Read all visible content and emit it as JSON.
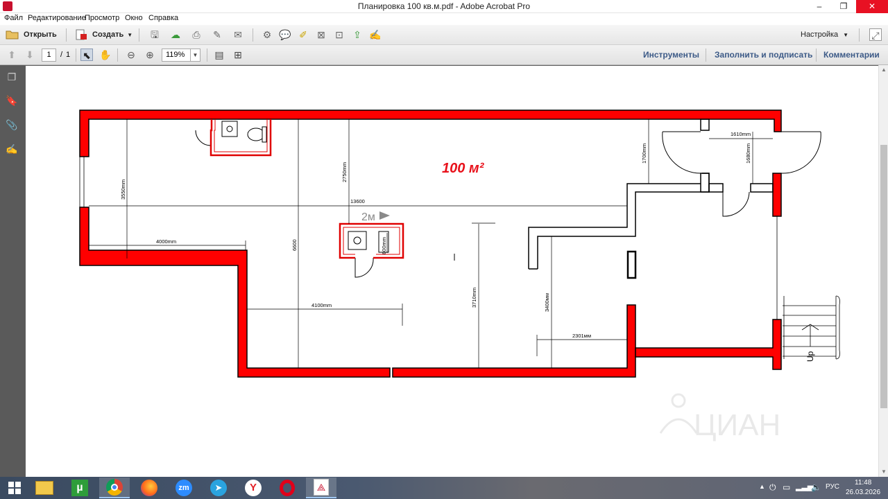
{
  "window": {
    "title": "Планировка 100 кв.м.pdf - Adobe Acrobat Pro",
    "minimize": "–",
    "restore": "❐",
    "close": "✕"
  },
  "menu": [
    "Файл",
    "Редактирование",
    "Просмотр",
    "Окно",
    "Справка"
  ],
  "toolbar": {
    "open_label": "Открыть",
    "create_label": "Создать",
    "customize_label": "Настройка"
  },
  "nav": {
    "page_current": "1",
    "page_sep": "/",
    "page_total": "1",
    "zoom": "119%"
  },
  "panels": {
    "tools": "Инструменты",
    "fill_sign": "Заполнить и подписать",
    "comments": "Комментарии"
  },
  "plan": {
    "area_label": "100 м²",
    "scale_label": "2м",
    "dims": {
      "d13600": "13600",
      "d4000": "4000mm",
      "d3550": "3550mm",
      "d6600": "6600",
      "d2750": "2750mm",
      "d4100": "4100mm",
      "d800": "800mm",
      "d3710": "3710mm",
      "d3400": "3400мм",
      "d2301": "2301мм",
      "d1700": "1700mm",
      "d1610": "1610mm",
      "d1680": "1680mm"
    },
    "stair_label": "Up",
    "watermark": "ЦИАН"
  },
  "colors": {
    "wall_red": "#ff0000",
    "link_blue": "#3c5a87",
    "area_text": "#e8101a"
  },
  "tray": {
    "lang": "РУС",
    "time": "11:48",
    "date": "26.03.2026"
  }
}
